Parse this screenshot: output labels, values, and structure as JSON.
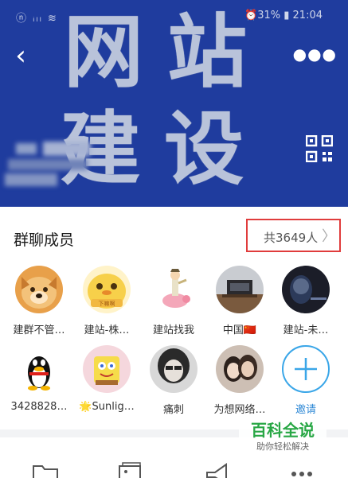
{
  "status_bar": {
    "left": "ⓝ ᵢₗₗ ≋",
    "right": "⏰31% ▮ 21:04"
  },
  "banner": {
    "line1": "网站",
    "line2": "建设"
  },
  "members": {
    "title": "群聊成员",
    "count": "共3649人",
    "items": [
      {
        "name": "建群不管…",
        "avatar": "dog"
      },
      {
        "name": "建站-株…",
        "avatar": "cartoon-chick"
      },
      {
        "name": "建站找我",
        "avatar": "pig-rider"
      },
      {
        "name": "中国🇨🇳",
        "avatar": "room"
      },
      {
        "name": "建站-未…",
        "avatar": "dark-portrait"
      },
      {
        "name": "3428828…",
        "avatar": "qq-penguin"
      },
      {
        "name": "🌟Sunlig…",
        "avatar": "sponge"
      },
      {
        "name": "痛刺",
        "avatar": "bw-portrait"
      },
      {
        "name": "为想网络…",
        "avatar": "couple"
      }
    ],
    "invite_label": "邀请"
  },
  "watermark": {
    "title": "百科全说",
    "subtitle": "助你轻松解决"
  },
  "colors": {
    "banner": "#1f3c9e",
    "accent": "#3aa6e8",
    "highlight": "#e03c3c"
  }
}
